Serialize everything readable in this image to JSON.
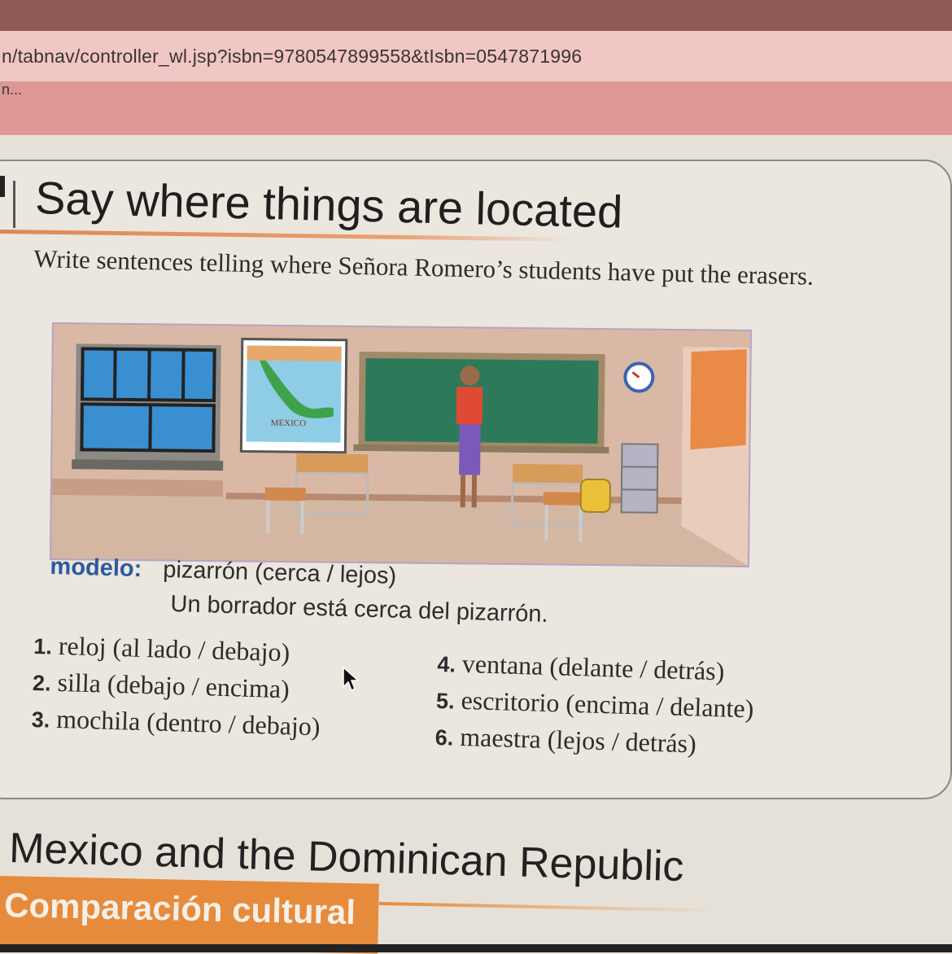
{
  "browser": {
    "url": "n/tabnav/controller_wl.jsp?isbn=9780547899558&tIsbn=0547871996",
    "sub_text": "n..."
  },
  "activity": {
    "title": "Say where things are located",
    "instructions": "Write sentences telling where Señora Romero’s students have put the erasers.",
    "illustration": {
      "map_label": "MEXICO"
    },
    "model": {
      "label": "modelo:",
      "prompt": "pizarrón (cerca / lejos)",
      "answer": "Un borrador está cerca del pizarrón."
    },
    "items_left": [
      {
        "num": "1.",
        "text": "reloj (al lado / debajo)"
      },
      {
        "num": "2.",
        "text": "silla (debajo / encima)"
      },
      {
        "num": "3.",
        "text": "mochila (dentro / debajo)"
      }
    ],
    "items_right": [
      {
        "num": "4.",
        "text": "ventana (delante / detrás)"
      },
      {
        "num": "5.",
        "text": "escritorio (encima / delante)"
      },
      {
        "num": "6.",
        "text": "maestra (lejos / detrás)"
      }
    ]
  },
  "section": {
    "heading": "Mexico and the Dominican Republic",
    "banner": "Comparación cultural"
  },
  "colors": {
    "accent_orange": "#e68b3c",
    "modelo_blue": "#2b5aa0",
    "url_bar": "#f0c7c4",
    "sub_bar": "#dd9895"
  }
}
